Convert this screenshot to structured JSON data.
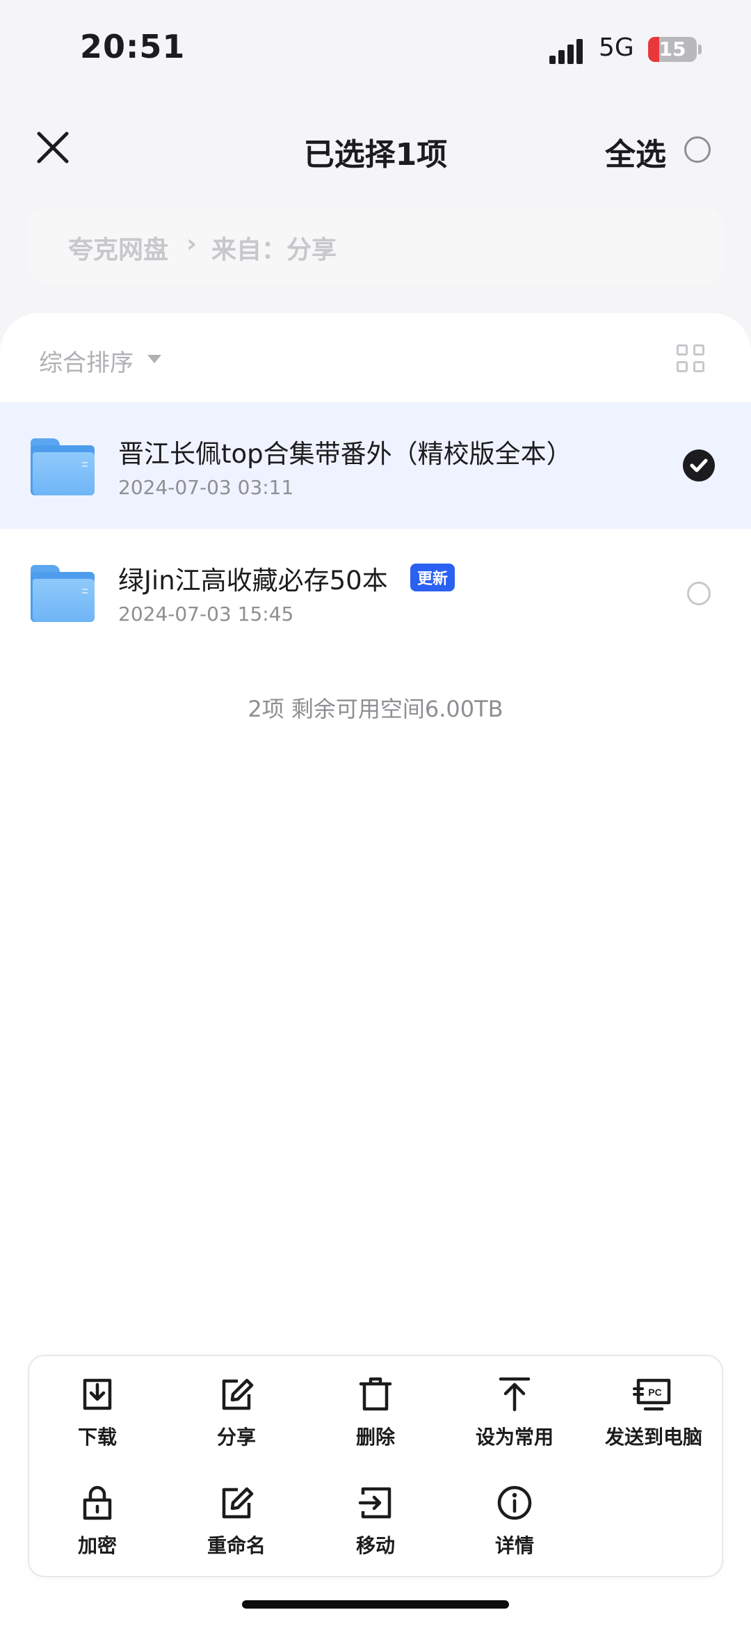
{
  "status_bar": {
    "time": "20:51",
    "network": "5G",
    "battery": "15"
  },
  "header": {
    "title": "已选择1项",
    "select_all": "全选"
  },
  "breadcrumb": {
    "root": "夸克网盘",
    "separator": "›",
    "current": "来自：分享"
  },
  "toolbar": {
    "sort_label": "综合排序"
  },
  "files": [
    {
      "name": "晋江长佩top合集带番外（精校版全本）",
      "date": "2024-07-03 03:11",
      "selected": true,
      "badge": ""
    },
    {
      "name": "绿Jin江高收藏必存50本",
      "date": "2024-07-03 15:45",
      "selected": false,
      "badge": "更新"
    }
  ],
  "summary": "2项 剩余可用空间6.00TB",
  "actions": {
    "download": "下载",
    "share": "分享",
    "delete": "删除",
    "set_common": "设为常用",
    "send_pc": "发送到电脑",
    "encrypt": "加密",
    "rename": "重命名",
    "move": "移动",
    "details": "详情",
    "pc_icon_text": "PC"
  },
  "colors": {
    "accent": "#2a61f3",
    "selected_row": "#eff3ff",
    "folder": "#6fb5f6"
  }
}
